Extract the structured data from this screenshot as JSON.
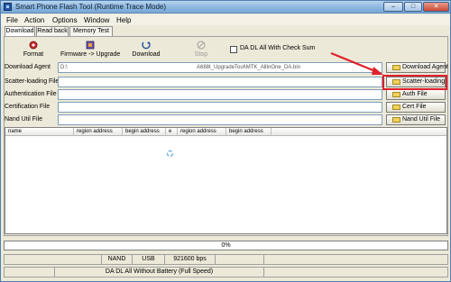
{
  "window": {
    "title": "Smart Phone Flash Tool (Runtime Trace Mode)",
    "controls": {
      "minimize": "–",
      "maximize": "□",
      "close": "✕"
    }
  },
  "menu": [
    "File",
    "Action",
    "Options",
    "Window",
    "Help"
  ],
  "tabs": [
    {
      "label": "Download",
      "active": true
    },
    {
      "label": "Read back",
      "active": false
    },
    {
      "label": "Memory Test",
      "active": false
    }
  ],
  "toolbar": {
    "format": "Format",
    "firmware_upgrade": "Firmware -> Upgrade",
    "download": "Download",
    "stop": "Stop",
    "checksum_label": "DA DL All With Check Sum",
    "checksum_checked": false
  },
  "files": [
    {
      "label": "Download Agent",
      "value_left": "D:\\",
      "value_right": "A688t_UpgradeTool\\MTK_AllInOne_DA.bin",
      "button": "Download Agent",
      "icon": "folder-open-icon"
    },
    {
      "label": "Scatter-loading File",
      "value_left": "",
      "value_right": "",
      "button": "Scatter-loading",
      "icon": "folder-open-icon"
    },
    {
      "label": "Authentication File",
      "value_left": "",
      "value_right": "",
      "button": "Auth File",
      "icon": "folder-open-icon"
    },
    {
      "label": "Certification File",
      "value_left": "",
      "value_right": "",
      "button": "Cert File",
      "icon": "folder-open-icon"
    },
    {
      "label": "Nand Util File",
      "value_left": "",
      "value_right": "",
      "button": "Nand Util File",
      "icon": "folder-open-icon"
    }
  ],
  "table": {
    "columns": [
      "name",
      "region address",
      "begin address",
      "e",
      "region address",
      "begin address"
    ]
  },
  "progress": {
    "text": "0%",
    "value": 0
  },
  "status": {
    "row1": [
      "",
      "NAND",
      "USB",
      "921600 bps",
      "",
      ""
    ],
    "row2": [
      "",
      "DA DL All Without Battery (Full Speed)",
      ""
    ]
  },
  "colors": {
    "highlight": "#e0212b",
    "title_bar": "#8bb6de"
  }
}
